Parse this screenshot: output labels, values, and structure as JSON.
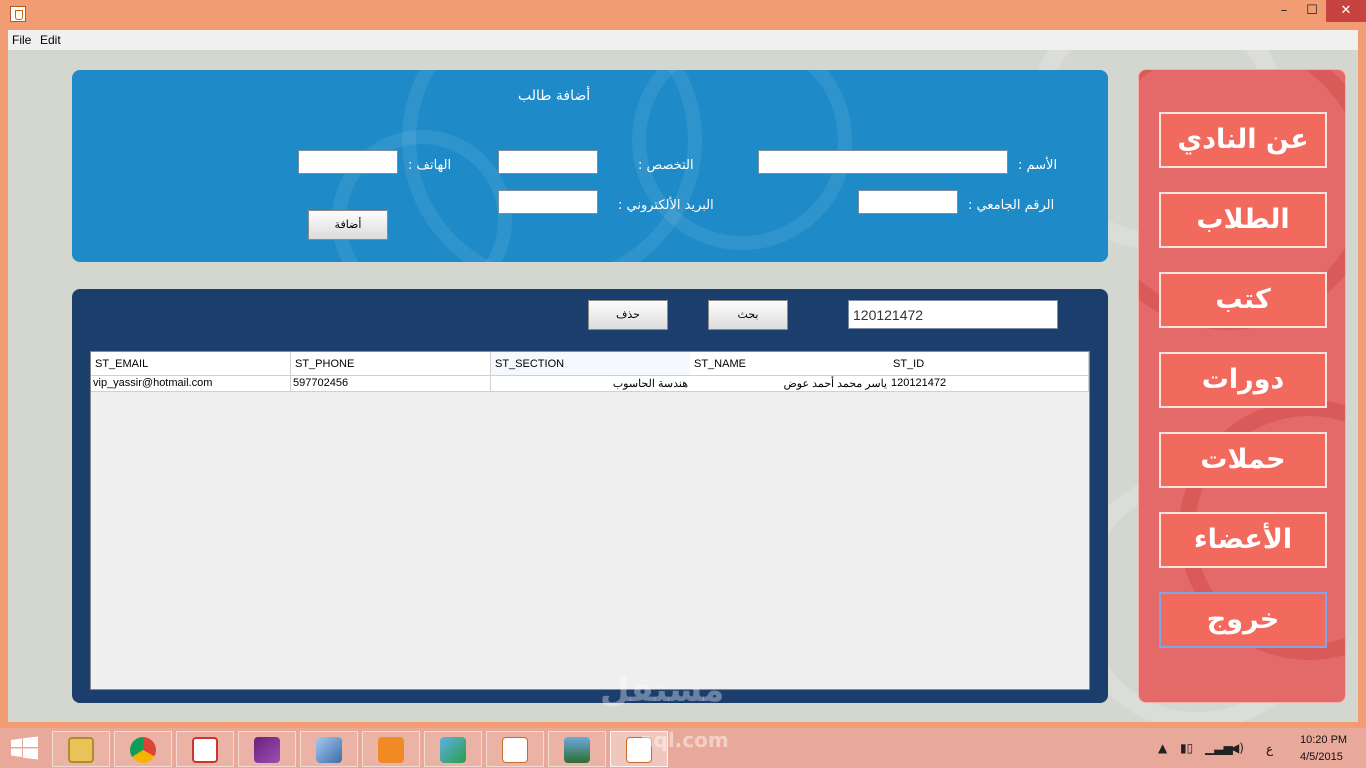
{
  "menu": {
    "file": "File",
    "edit": "Edit"
  },
  "window": {
    "minimize": "–",
    "maximize": "☐",
    "close": "✕"
  },
  "form": {
    "title": "أضافة طالب",
    "name_label": "الأسم :",
    "section_label": "التخصص :",
    "phone_label": "الهاتف :",
    "student_id_label": "الرقم الجامعي :",
    "email_label": "البريد الألكتروني :",
    "add_button": "أضافة",
    "name_value": "",
    "section_value": "",
    "phone_value": "",
    "student_id_value": "",
    "email_value": ""
  },
  "search": {
    "value": "120121472",
    "search_button": "بحث",
    "delete_button": "حذف"
  },
  "table": {
    "columns": [
      "ST_EMAIL",
      "ST_PHONE",
      "ST_SECTION",
      "ST_NAME",
      "ST_ID"
    ],
    "rows": [
      [
        "vip_yassir@hotmail.com",
        "597702456",
        "هندسة الحاسوب",
        "ياسر محمد أحمد عوض",
        "120121472"
      ]
    ]
  },
  "side_menu": [
    "عن النادي",
    "الطلاب",
    "كتب",
    "دورات",
    "حملات",
    "الأعضاء",
    "خروج"
  ],
  "taskbar": {
    "apps": [
      "file-explorer",
      "chrome",
      "snipping-tool",
      "visual-studio",
      "virtualbox",
      "foxit-pdf",
      "media-player",
      "java",
      "photos",
      "java-active"
    ],
    "time": "10:20 PM",
    "date": "4/5/2015",
    "lang": "ع"
  },
  "watermark": {
    "main": "مستقل",
    "sub": "aql.com"
  },
  "colors": {
    "titlebar": "#f29c73",
    "form_panel": "#1e8bc8",
    "list_panel": "#1b3e6d",
    "side_panel": "#e46a6a",
    "side_button": "#f26a5e"
  }
}
